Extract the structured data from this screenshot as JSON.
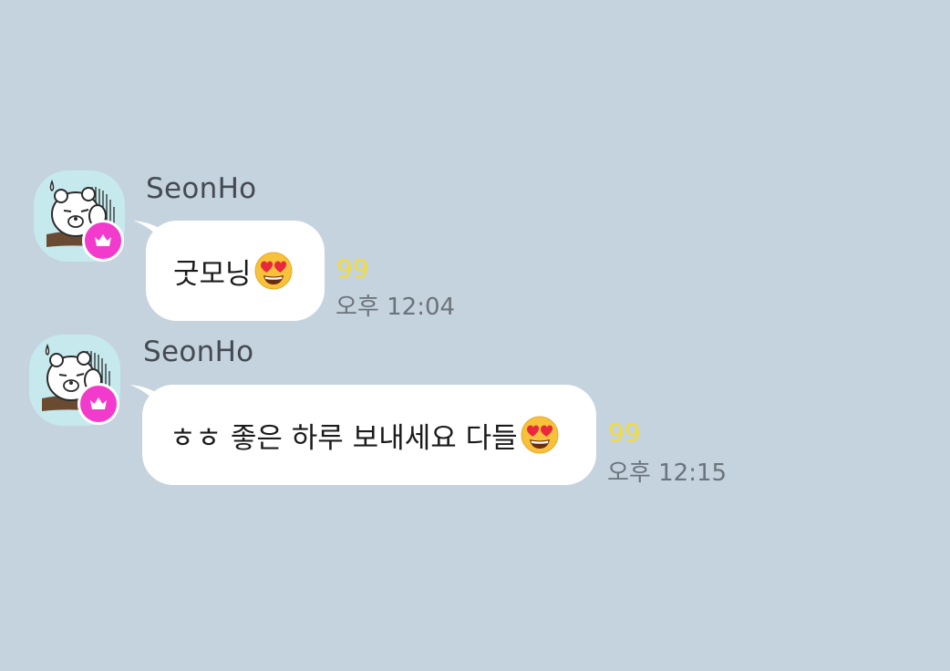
{
  "messages": [
    {
      "sender": "SeonHo",
      "text": "굿모닝",
      "emoji": "heart-eyes-emoji",
      "unread_count": "99",
      "time": "오후 12:04"
    },
    {
      "sender": "SeonHo",
      "text": "ㅎㅎ 좋은 하루 보내세요 다들",
      "emoji": "heart-eyes-emoji",
      "unread_count": "99",
      "time": "오후 12:15"
    }
  ],
  "colors": {
    "background": "#c5d3df",
    "bubble": "#ffffff",
    "unread": "#f2dc3a",
    "crown_badge": "#f23bcd",
    "avatar_bg": "#c6e9ee"
  },
  "icons": {
    "avatar": "bear-avatar-icon",
    "badge": "crown-icon"
  }
}
